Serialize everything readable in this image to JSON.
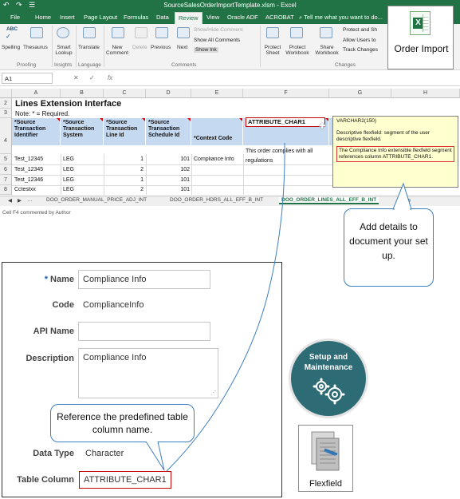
{
  "window": {
    "title": "SourceSalesOrderImportTemplate.xlsm - Excel",
    "quick_access": "↶ ↷ ☰"
  },
  "ribbon_tabs": [
    "File",
    "Home",
    "Insert",
    "Page Layout",
    "Formulas",
    "Data",
    "Review",
    "View",
    "Oracle ADF",
    "ACROBAT",
    "⌕ Tell me what you want to do..."
  ],
  "active_tab": "Review",
  "ribbon": {
    "spelling": "Spelling",
    "thesaurus": "Thesaurus",
    "smart_lookup": "Smart Lookup",
    "translate": "Translate",
    "new_comment": "New Comment",
    "delete": "Delete",
    "previous": "Previous",
    "next": "Next",
    "show_hide_comment": "Show/Hide Comment",
    "show_all_comments": "Show All Comments",
    "show_ink": "Show Ink",
    "protect_sheet": "Protect Sheet",
    "protect_workbook": "Protect Workbook",
    "share_workbook": "Share Workbook",
    "protect_and_share": "Protect and Sh",
    "allow_users": "Allow Users to",
    "track_changes": "Track Changes",
    "groups": {
      "proofing": "Proofing",
      "insights": "Insights",
      "language": "Language",
      "comments": "Comments",
      "changes": "Changes"
    }
  },
  "order_import": {
    "label": "Order Import"
  },
  "formula_bar": {
    "name_box": "A1",
    "fx": "fx"
  },
  "sheet": {
    "columns": [
      "A",
      "B",
      "C",
      "D",
      "E",
      "F",
      "G",
      "H"
    ],
    "rows": [
      "2",
      "3",
      "4",
      "5",
      "6",
      "7",
      "8"
    ],
    "title": "Lines Extension Interface",
    "note": "Note: * = Required.",
    "headers": {
      "a": "*Source Transaction Identifier",
      "b": "*Source Transaction System",
      "c": "*Source Transaction Line Id",
      "d": "*Source Transaction Schedule Id",
      "e": "*Context Code",
      "f": "ATTRIBUTE_CHAR1"
    },
    "data": [
      {
        "a": "Test_12345",
        "b": "LEG",
        "c": "1",
        "d": "101",
        "e": "Compliance Info",
        "f": "This order complies with all regulations"
      },
      {
        "a": "Test_12345",
        "b": "LEG",
        "c": "2",
        "d": "102",
        "e": "",
        "f": ""
      },
      {
        "a": "Test_12346",
        "b": "LEG",
        "c": "1",
        "d": "101",
        "e": "",
        "f": ""
      },
      {
        "a": "Cctestxx",
        "b": "LEG",
        "c": "2",
        "d": "101",
        "e": "",
        "f": ""
      }
    ]
  },
  "comment": {
    "type": "VARCHAR2(150)",
    "desc": "Descriptive flexfield: segment of the user descriptive flexfield.",
    "highlight": "The Compliance Info extensible flexfield segment references column ATTRIBUTE_CHAR1."
  },
  "sheet_tabs": [
    "DOO_ORDER_MANUAL_PRICE_ADJ_INT",
    "DOO_ORDER_HDRS_ALL_EFF_B_INT",
    "DOO_ORDER_LINES_ALL_EFF_B_INT"
  ],
  "active_sheet": "DOO_ORDER_LINES_ALL_EFF_B_INT",
  "status_bar": "Cell F4 commented by Author",
  "callout_add": "Add details to document your set up.",
  "form": {
    "name_label": "Name",
    "name_value": "Compliance Info",
    "code_label": "Code",
    "code_value": "ComplianceInfo",
    "api_label": "API Name",
    "api_value": "",
    "desc_label": "Description",
    "desc_value": "Compliance Info",
    "dtype_label": "Data Type",
    "dtype_value": "Character",
    "tcol_label": "Table Column",
    "tcol_value": "ATTRIBUTE_CHAR1"
  },
  "callout_ref": "Reference the predefined table column name.",
  "setup": {
    "label": "Setup and Maintenance"
  },
  "flexfield": {
    "label": "Flexfield"
  }
}
